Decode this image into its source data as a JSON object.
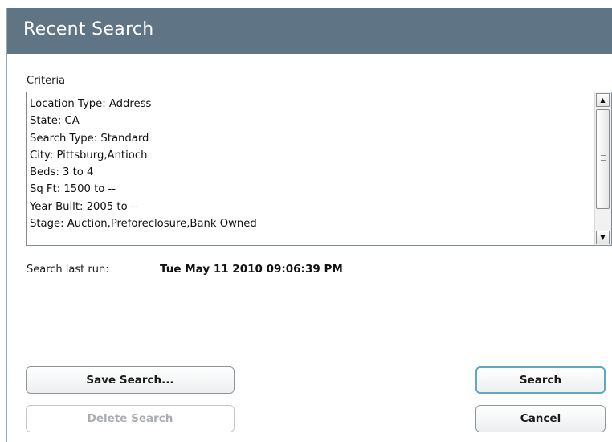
{
  "dialog": {
    "title": "Recent Search"
  },
  "criteria": {
    "label": "Criteria",
    "lines": [
      "Location Type: Address",
      "State: CA",
      "Search Type: Standard",
      "City: Pittsburg,Antioch",
      "Beds: 3 to 4",
      "Sq Ft: 1500 to --",
      "Year Built: 2005 to --",
      "Stage: Auction,Preforeclosure,Bank Owned"
    ],
    "scroll_up_glyph": "▲",
    "scroll_down_glyph": "▼"
  },
  "last_run": {
    "label": "Search last run:",
    "value": "Tue May 11 2010 09:06:39 PM"
  },
  "buttons": {
    "save_label": "Save Search...",
    "delete_label": "Delete Search",
    "search_label": "Search",
    "cancel_label": "Cancel"
  },
  "colors": {
    "titlebar": "#5f7484",
    "search_button_focus": "#5fa8bf"
  }
}
